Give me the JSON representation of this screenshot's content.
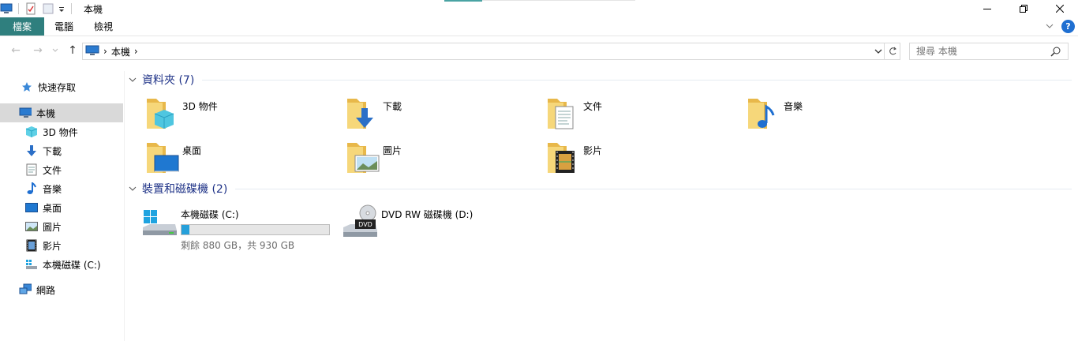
{
  "window": {
    "title": "本機"
  },
  "ribbon": {
    "tabs": [
      {
        "label": "檔案"
      },
      {
        "label": "電腦"
      },
      {
        "label": "檢視"
      }
    ]
  },
  "address": {
    "crumbs": [
      "本機"
    ],
    "search_placeholder": "搜尋 本機"
  },
  "nav": {
    "items": [
      {
        "label": "快速存取",
        "icon": "star-icon"
      },
      {
        "label": "本機",
        "icon": "computer-icon",
        "selected": true
      },
      {
        "label": "3D 物件",
        "icon": "cube-icon"
      },
      {
        "label": "下載",
        "icon": "download-arrow-icon"
      },
      {
        "label": "文件",
        "icon": "document-icon"
      },
      {
        "label": "音樂",
        "icon": "music-note-icon"
      },
      {
        "label": "桌面",
        "icon": "desktop-icon"
      },
      {
        "label": "圖片",
        "icon": "picture-icon"
      },
      {
        "label": "影片",
        "icon": "film-icon"
      },
      {
        "label": "本機磁碟 (C:)",
        "icon": "drive-icon"
      },
      {
        "label": "網路",
        "icon": "network-icon"
      }
    ]
  },
  "groups": {
    "folders": {
      "title": "資料夾 (7)",
      "items": [
        {
          "label": "3D 物件"
        },
        {
          "label": "下載"
        },
        {
          "label": "文件"
        },
        {
          "label": "音樂"
        },
        {
          "label": "桌面"
        },
        {
          "label": "圖片"
        },
        {
          "label": "影片"
        }
      ]
    },
    "drives": {
      "title": "裝置和磁碟機 (2)",
      "items": [
        {
          "label": "本機磁碟 (C:)",
          "free_text": "剩餘 880 GB，共 930 GB",
          "used_fraction": 0.054
        },
        {
          "label": "DVD RW 磁碟機 (D:)"
        }
      ]
    }
  },
  "colors": {
    "file_tab": "#2f7f7e",
    "group_title": "#1e3287",
    "selection": "#d9d9d9",
    "progress": "#26a0da"
  }
}
